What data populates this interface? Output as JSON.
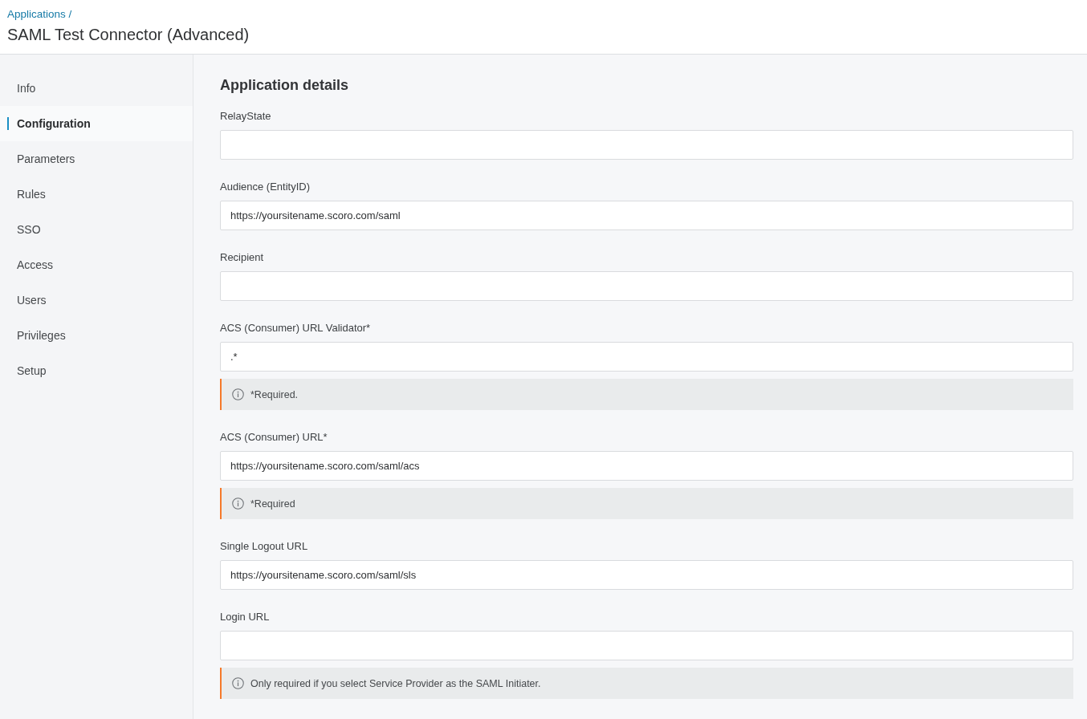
{
  "breadcrumb": "Applications /",
  "title": "SAML Test Connector (Advanced)",
  "sidebar": {
    "items": [
      {
        "label": "Info",
        "selected": false
      },
      {
        "label": "Configuration",
        "selected": true
      },
      {
        "label": "Parameters",
        "selected": false
      },
      {
        "label": "Rules",
        "selected": false
      },
      {
        "label": "SSO",
        "selected": false
      },
      {
        "label": "Access",
        "selected": false
      },
      {
        "label": "Users",
        "selected": false
      },
      {
        "label": "Privileges",
        "selected": false
      },
      {
        "label": "Setup",
        "selected": false
      }
    ]
  },
  "section": {
    "title": "Application details",
    "fields": [
      {
        "label": "RelayState"
      },
      {
        "label": "Audience (EntityID)",
        "value": "https://yoursitename.scoro.com/saml"
      },
      {
        "label": "Recipient"
      },
      {
        "label": "ACS (Consumer) URL Validator*",
        "value": ".*",
        "note": "*Required."
      },
      {
        "label": "ACS (Consumer) URL*",
        "value": "https://yoursitename.scoro.com/saml/acs",
        "note": "*Required"
      },
      {
        "label": "Single Logout URL",
        "value": "https://yoursitename.scoro.com/saml/sls"
      },
      {
        "label": "Login URL",
        "note": "Only required if you select Service Provider as the SAML Initiater."
      }
    ]
  }
}
